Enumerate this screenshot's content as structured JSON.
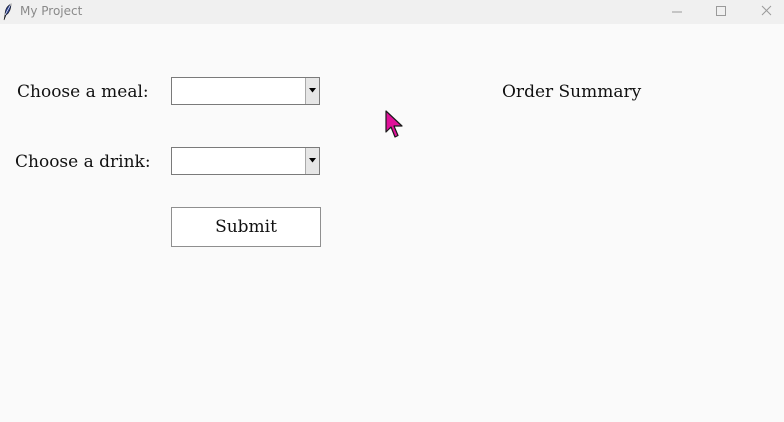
{
  "window": {
    "title": "My Project",
    "icon": "feather-icon"
  },
  "form": {
    "meal_label": "Choose a meal:",
    "meal_value": "",
    "drink_label": "Choose a drink:",
    "drink_value": "",
    "submit_label": "Submit"
  },
  "summary": {
    "title": "Order Summary"
  },
  "colors": {
    "cursor": "#e0119a",
    "background": "#fafafa"
  }
}
